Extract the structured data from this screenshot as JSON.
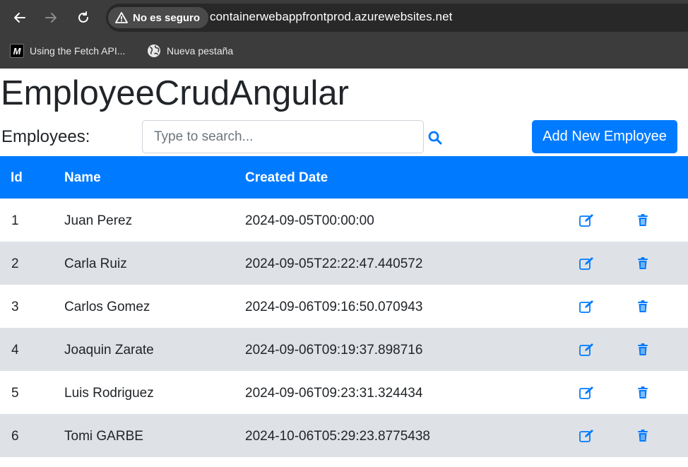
{
  "browser": {
    "security_label": "No es seguro",
    "url": "containerwebappfrontprod.azurewebsites.net",
    "bookmarks": [
      {
        "label": "Using the Fetch API...",
        "icon": "mdn-logo-icon"
      },
      {
        "label": "Nueva pestaña",
        "icon": "globe-icon"
      }
    ]
  },
  "app": {
    "title": "EmployeeCrudAngular",
    "employees_label": "Employees:",
    "search_placeholder": "Type to search...",
    "search_value": "",
    "add_button_label": "Add New Employee"
  },
  "table": {
    "headers": [
      "Id",
      "Name",
      "Created Date"
    ],
    "rows": [
      {
        "id": "1",
        "name": "Juan Perez",
        "created": "2024-09-05T00:00:00"
      },
      {
        "id": "2",
        "name": "Carla Ruiz",
        "created": "2024-09-05T22:22:47.440572"
      },
      {
        "id": "3",
        "name": "Carlos Gomez",
        "created": "2024-09-06T09:16:50.070943"
      },
      {
        "id": "4",
        "name": "Joaquin Zarate",
        "created": "2024-09-06T09:19:37.898716"
      },
      {
        "id": "5",
        "name": "Luis Rodriguez",
        "created": "2024-09-06T09:23:31.324434"
      },
      {
        "id": "6",
        "name": "Tomi GARBE",
        "created": "2024-10-06T05:29:23.8775438"
      }
    ],
    "row_actions": [
      "edit-icon",
      "trash-icon"
    ]
  },
  "colors": {
    "primary": "#007bff",
    "stripe": "#dee2e6",
    "chrome": "#3c3c3c"
  }
}
